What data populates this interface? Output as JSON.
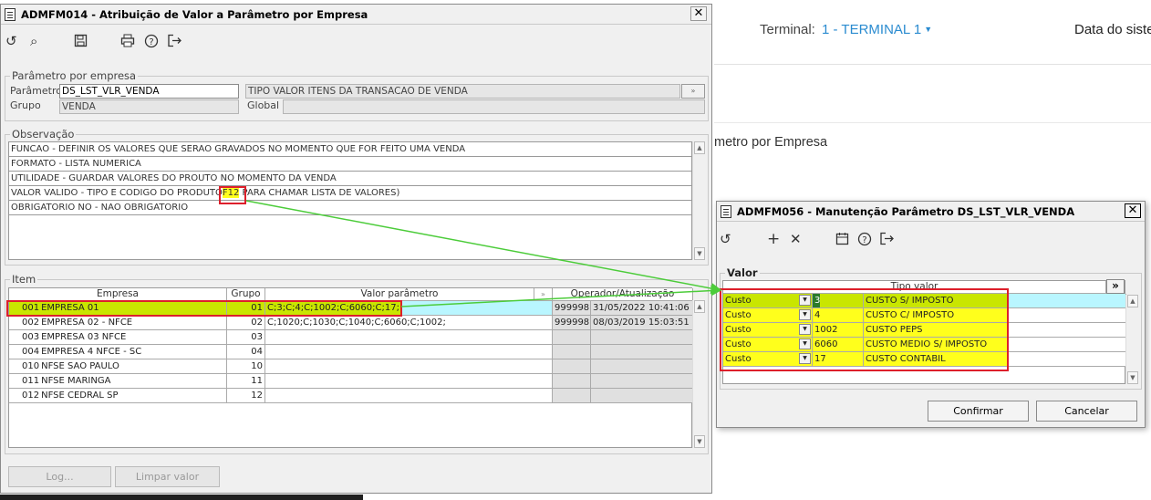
{
  "bg": {
    "terminal_label": "Terminal:",
    "terminal_value": "1 - TERMINAL 1",
    "date_label": "Data do siste",
    "page_fragment": "metro por Empresa"
  },
  "w1": {
    "title": "ADMFM014 - Atribuição de Valor a Parâmetro por Empresa",
    "param_group": {
      "label": "Parâmetro por empresa",
      "param_label": "Parâmetro",
      "param_value": "DS_LST_VLR_VENDA",
      "tipo_valor": "TIPO VALOR  ITENS DA TRANSACAO DE VENDA",
      "grupo_label": "Grupo",
      "grupo_value": "VENDA",
      "global_label": "Global",
      "global_value": ""
    },
    "obs": {
      "label": "Observação",
      "lines": [
        "FUNCAO -  DEFINIR OS VALORES QUE SERAO GRAVADOS NO MOMENTO QUE FOR FEITO UMA VENDA",
        "FORMATO - LISTA NUMERICA",
        "UTILIDADE - GUARDAR VALORES DO PROUTO NO MOMENTO DA VENDA",
        "VALOR VALIDO - TIPO E CODIGO DO PRODUTO",
        "OBRIGATORIO NO - NAO OBRIGATORIO"
      ],
      "f12": "F12",
      "after_f12": " PARA CHAMAR LISTA DE VALORES)"
    },
    "item": {
      "label": "Item",
      "headers": [
        "Empresa",
        "Grupo",
        "Valor parâmetro",
        "Operador/Atualização"
      ],
      "rows": [
        {
          "code": "001",
          "name": "EMPRESA 01",
          "grupo": "01",
          "valor": "C;3;C;4;C;1002;C;6060;C;17;",
          "op": "999998",
          "dt": "31/05/2022 10:41:06"
        },
        {
          "code": "002",
          "name": "EMPRESA 02 - NFCE",
          "grupo": "02",
          "valor": "C;1020;C;1030;C;1040;C;6060;C;1002;",
          "op": "999998",
          "dt": "08/03/2019 15:03:51"
        },
        {
          "code": "003",
          "name": "EMPRESA 03 NFCE",
          "grupo": "03",
          "valor": "",
          "op": "",
          "dt": ""
        },
        {
          "code": "004",
          "name": "EMPRESA 4 NFCE - SC",
          "grupo": "04",
          "valor": "",
          "op": "",
          "dt": ""
        },
        {
          "code": "010",
          "name": "NFSE SAO PAULO",
          "grupo": "10",
          "valor": "",
          "op": "",
          "dt": ""
        },
        {
          "code": "011",
          "name": "NFSE MARINGA",
          "grupo": "11",
          "valor": "",
          "op": "",
          "dt": ""
        },
        {
          "code": "012",
          "name": "NFSE CEDRAL SP",
          "grupo": "12",
          "valor": "",
          "op": "",
          "dt": ""
        }
      ]
    },
    "buttons": {
      "log": "Log...",
      "limpar": "Limpar valor"
    }
  },
  "w2": {
    "title": "ADMFM056 - Manutenção Parâmetro DS_LST_VLR_VENDA",
    "valor_label": "Valor",
    "tipo_header": "Tipo valor",
    "expand": "»",
    "rows": [
      {
        "type": "Custo",
        "code": "3",
        "desc": "CUSTO S/ IMPOSTO"
      },
      {
        "type": "Custo",
        "code": "4",
        "desc": "CUSTO C/ IMPOSTO"
      },
      {
        "type": "Custo",
        "code": "1002",
        "desc": "CUSTO PEPS"
      },
      {
        "type": "Custo",
        "code": "6060",
        "desc": "CUSTO MEDIO S/ IMPOSTO"
      },
      {
        "type": "Custo",
        "code": "17",
        "desc": "CUSTO CONTABIL"
      }
    ],
    "confirm": "Confirmar",
    "cancel": "Cancelar"
  },
  "colors": {
    "highlight_red": "#dd1f2b",
    "arrow_green": "#4ccc3a",
    "row_yellow": "#ffff1c",
    "row_lime": "#c9e600",
    "sel_cyan": "#b9f6ff",
    "link_blue": "#2a8bd0"
  },
  "icons": [
    "refresh-icon",
    "search-icon",
    "save-icon",
    "print-icon",
    "help-icon",
    "exit-icon",
    "add-icon",
    "delete-icon",
    "calendar-icon"
  ]
}
